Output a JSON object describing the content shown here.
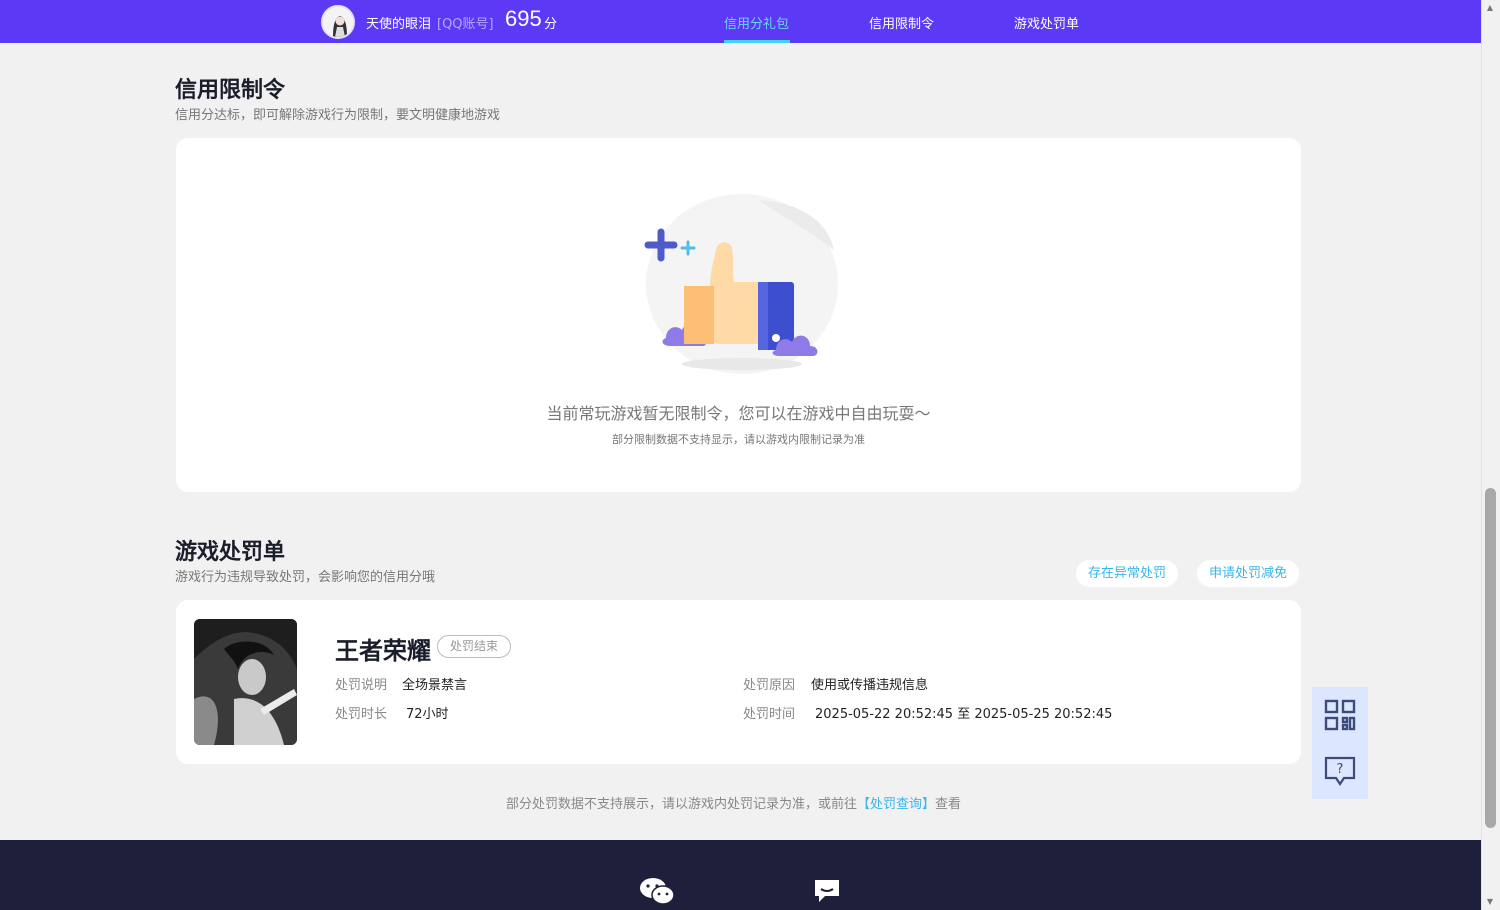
{
  "header": {
    "username": "天使的眼泪",
    "account_type": "[QQ账号]",
    "score": "695",
    "score_unit": "分",
    "tabs": [
      {
        "label": "信用分礼包",
        "active": true
      },
      {
        "label": "信用限制令",
        "active": false
      },
      {
        "label": "游戏处罚单",
        "active": false
      }
    ]
  },
  "restriction": {
    "title": "信用限制令",
    "subtitle": "信用分达标，即可解除游戏行为限制，要文明健康地游戏",
    "empty_message": "当前常玩游戏暂无限制令，您可以在游戏中自由玩耍～",
    "empty_note": "部分限制数据不支持显示，请以游戏内限制记录为准"
  },
  "penalty": {
    "title": "游戏处罚单",
    "subtitle": "游戏行为违规导致处罚，会影响您的信用分哦",
    "buttons": {
      "abnormal": "存在异常处罚",
      "reduce": "申请处罚减免"
    },
    "record": {
      "game": "王者荣耀",
      "status": "处罚结束",
      "desc_label": "处罚说明",
      "desc_value": "全场景禁言",
      "reason_label": "处罚原因",
      "reason_value": "使用或传播违规信息",
      "duration_label": "处罚时长",
      "duration_value": "72小时",
      "time_label": "处罚时间",
      "time_value": "2025-05-22 20:52:45 至 2025-05-25 20:52:45"
    },
    "footnote_prefix": "部分处罚数据不支持展示，请以游戏内处罚记录为准，或前往",
    "footnote_link": "【处罚查询】",
    "footnote_suffix": "查看"
  },
  "floating": {
    "items": [
      "qr-code-icon",
      "help-chat-icon"
    ]
  },
  "footer": {
    "icons": [
      "wechat-icon",
      "message-icon"
    ]
  },
  "colors": {
    "nav_bg": "#5b39f5",
    "accent": "#3ab6ea",
    "footer_bg": "#1e1f3b"
  }
}
